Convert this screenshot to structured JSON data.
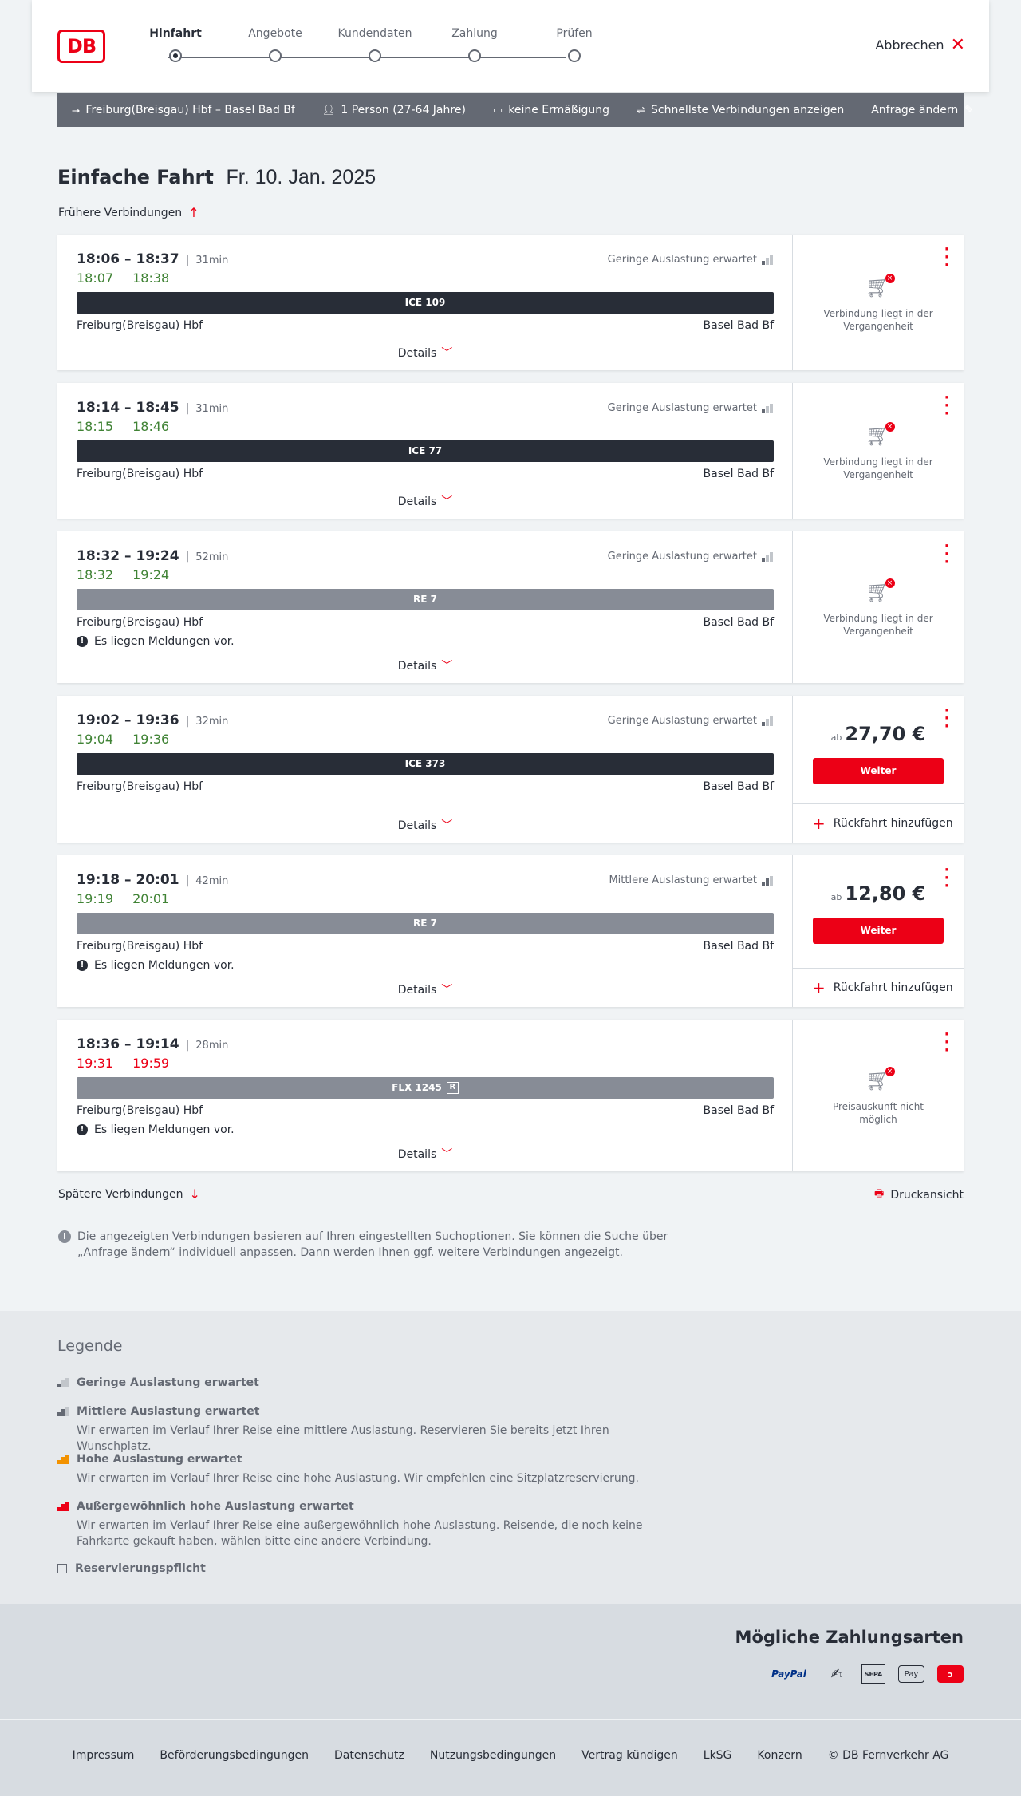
{
  "header": {
    "logo": "DB",
    "steps": [
      "Hinfahrt",
      "Angebote",
      "Kundendaten",
      "Zahlung",
      "Prüfen"
    ],
    "active_step": 0,
    "cancel_label": "Abbrechen"
  },
  "query": {
    "route": "Freiburg(Breisgau) Hbf – Basel Bad Bf",
    "passengers": "1 Person (27-64 Jahre)",
    "discount": "keine Ermäßigung",
    "fastest": "Schnellste Verbindungen anzeigen",
    "change": "Anfrage ändern"
  },
  "headline": {
    "title": "Einfache Fahrt",
    "date": "Fr. 10. Jan. 2025"
  },
  "earlier_label": "Frühere Verbindungen",
  "later_label": "Spätere Verbindungen",
  "print_label": "Druckansicht",
  "connections": [
    {
      "times": "18:06 – 18:37",
      "duration": "31min",
      "rt_dep": "18:07",
      "rt_arr": "18:38",
      "rt_color": "green",
      "load": "Geringe Auslastung erwartet",
      "train": "ICE 109",
      "train_style": "dark",
      "from": "Freiburg(Breisgau) Hbf",
      "to": "Basel Bad Bf",
      "message": "",
      "details": "Details",
      "status": "Verbindung liegt in der Vergangenheit"
    },
    {
      "times": "18:14 – 18:45",
      "duration": "31min",
      "rt_dep": "18:15",
      "rt_arr": "18:46",
      "rt_color": "green",
      "load": "Geringe Auslastung erwartet",
      "train": "ICE 77",
      "train_style": "dark",
      "from": "Freiburg(Breisgau) Hbf",
      "to": "Basel Bad Bf",
      "message": "",
      "details": "Details",
      "status": "Verbindung liegt in der Vergangenheit"
    },
    {
      "times": "18:32 – 19:24",
      "duration": "52min",
      "rt_dep": "18:32",
      "rt_arr": "19:24",
      "rt_color": "green",
      "load": "Geringe Auslastung erwartet",
      "train": "RE 7",
      "train_style": "grey",
      "from": "Freiburg(Breisgau) Hbf",
      "to": "Basel Bad Bf",
      "message": "Es liegen Meldungen vor.",
      "details": "Details",
      "status": "Verbindung liegt in der Vergangenheit"
    },
    {
      "times": "19:02 – 19:36",
      "duration": "32min",
      "rt_dep": "19:04",
      "rt_arr": "19:36",
      "rt_color": "green",
      "load": "Geringe Auslastung erwartet",
      "train": "ICE 373",
      "train_style": "dark",
      "from": "Freiburg(Breisgau) Hbf",
      "to": "Basel Bad Bf",
      "message": "",
      "details": "Details",
      "price_prefix": "ab",
      "price": "27,70 €",
      "button": "Weiter",
      "return": "Rückfahrt hinzufügen"
    },
    {
      "times": "19:18 – 20:01",
      "duration": "42min",
      "rt_dep": "19:19",
      "rt_arr": "20:01",
      "rt_color": "green",
      "load": "Mittlere Auslastung erwartet",
      "train": "RE 7",
      "train_style": "grey",
      "from": "Freiburg(Breisgau) Hbf",
      "to": "Basel Bad Bf",
      "message": "Es liegen Meldungen vor.",
      "details": "Details",
      "price_prefix": "ab",
      "price": "12,80 €",
      "button": "Weiter",
      "return": "Rückfahrt hinzufügen"
    },
    {
      "times": "18:36 – 19:14",
      "duration": "28min",
      "rt_dep": "19:31",
      "rt_arr": "19:59",
      "rt_color": "red",
      "load": "",
      "train": "FLX 1245",
      "train_style": "grey",
      "train_badge": "R",
      "from": "Freiburg(Breisgau) Hbf",
      "to": "Basel Bad Bf",
      "message": "Es liegen Meldungen vor.",
      "details": "Details",
      "status": "Preisauskunft nicht möglich"
    }
  ],
  "info_text": "Die angezeigten Verbindungen basieren auf Ihren eingestellten Suchoptionen. Sie können die Suche über „Anfrage ändern“ individuell anpassen. Dann werden Ihnen ggf. weitere Verbindungen angezeigt.",
  "legend": {
    "title": "Legende",
    "items": [
      {
        "title": "Geringe Auslastung erwartet",
        "desc": ""
      },
      {
        "title": "Mittlere Auslastung erwartet",
        "desc": "Wir erwarten im Verlauf Ihrer Reise eine mittlere Auslastung. Reservieren Sie bereits jetzt Ihren Wunschplatz."
      },
      {
        "title": "Hohe Auslastung erwartet",
        "desc": "Wir erwarten im Verlauf Ihrer Reise eine hohe Auslastung. Wir empfehlen eine Sitzplatzreservierung."
      },
      {
        "title": "Außergewöhnlich hohe Auslastung erwartet",
        "desc": "Wir erwarten im Verlauf Ihrer Reise eine außergewöhnlich hohe Auslastung. Reisende, die noch keine Fahrkarte gekauft haben, wählen bitte eine andere Verbindung."
      },
      {
        "title": "Reservierungspflicht",
        "desc": ""
      }
    ]
  },
  "payment": {
    "title": "Mögliche Zahlungsarten",
    "methods": [
      "PayPal",
      "SEPA",
      "Pay"
    ]
  },
  "footer": {
    "links": [
      "Impressum",
      "Beförderungsbedingungen",
      "Datenschutz",
      "Nutzungsbedingungen",
      "Vertrag kündigen",
      "LkSG",
      "Konzern"
    ],
    "copyright": "© DB Fernverkehr AG"
  },
  "colors": {
    "brand": "#ec0016",
    "realtime_ok": "#408335",
    "dark": "#282d37",
    "grey": "#878c96"
  }
}
